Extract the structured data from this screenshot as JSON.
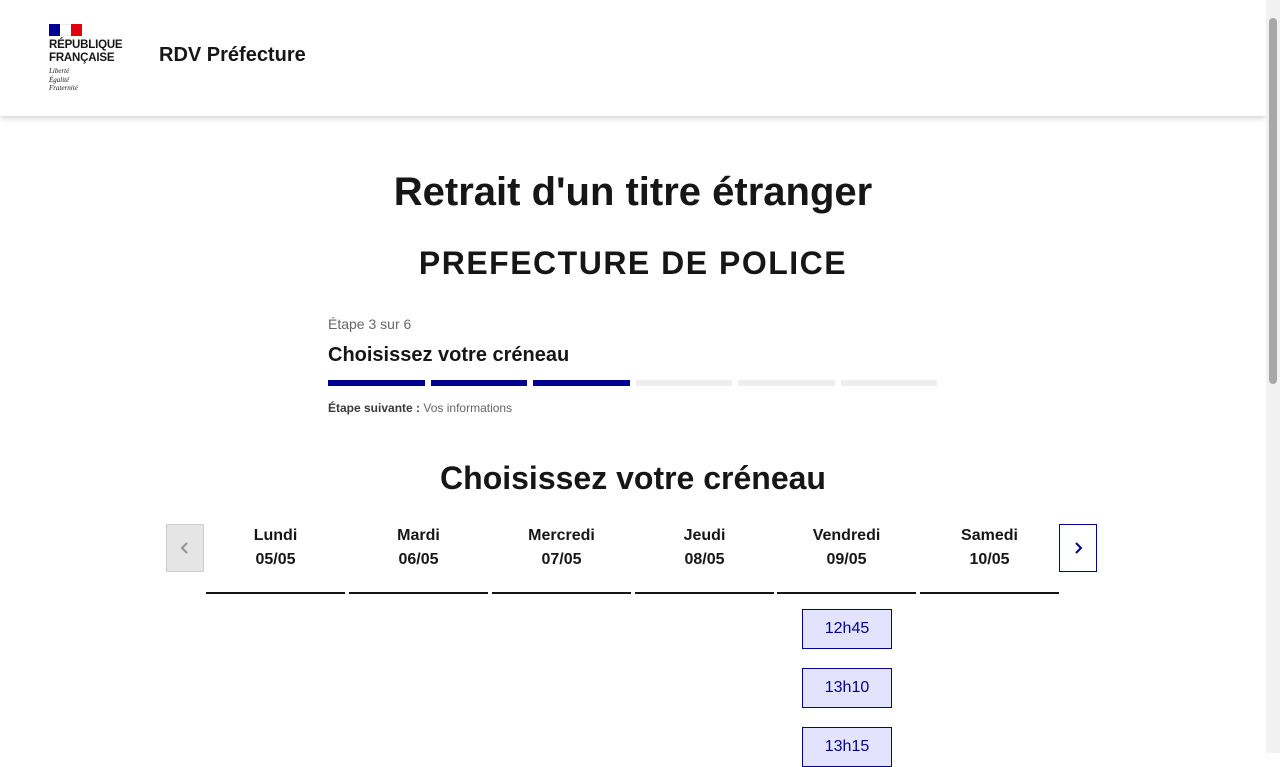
{
  "header": {
    "logo": {
      "line1": "RÉPUBLIQUE",
      "line2": "FRANÇAISE",
      "motto1": "Liberté",
      "motto2": "Égalité",
      "motto3": "Fraternité"
    },
    "service_title": "RDV Préfecture"
  },
  "main": {
    "title": "Retrait d'un titre étranger",
    "organization": "PREFECTURE DE POLICE"
  },
  "stepper": {
    "state": "Étape 3 sur 6",
    "title": "Choisissez votre créneau",
    "current_step": 3,
    "total_steps": 6,
    "next_label": "Étape suivante :",
    "next_value": "Vos informations"
  },
  "slots_section": {
    "title": "Choisissez votre créneau",
    "prev_icon": "chevron-left-icon",
    "next_icon": "chevron-right-icon",
    "days": [
      {
        "name": "Lundi",
        "date": "05/05"
      },
      {
        "name": "Mardi",
        "date": "06/05"
      },
      {
        "name": "Mercredi",
        "date": "07/05"
      },
      {
        "name": "Jeudi",
        "date": "08/05"
      },
      {
        "name": "Vendredi",
        "date": "09/05"
      },
      {
        "name": "Samedi",
        "date": "10/05"
      }
    ],
    "slots": [
      "12h45",
      "13h10",
      "13h15"
    ]
  },
  "colors": {
    "primary": "#000091",
    "slot_bg": "#e3e3fd",
    "flag_blue": "#000091",
    "flag_red": "#e1000f"
  }
}
